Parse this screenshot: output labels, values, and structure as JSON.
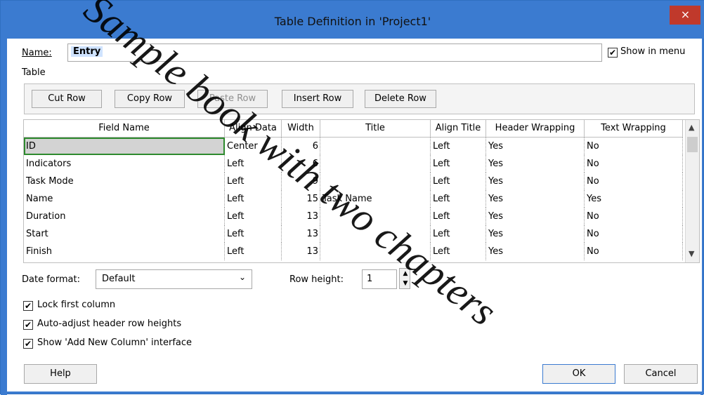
{
  "window": {
    "title": "Table Definition in 'Project1'",
    "close_glyph": "×"
  },
  "name_field": {
    "label": "Name:",
    "value": "Entry"
  },
  "show_in_menu": {
    "label": "Show in menu",
    "checked": true
  },
  "table_section": {
    "label": "Table"
  },
  "toolbar": {
    "buttons": [
      {
        "label": "Cut Row"
      },
      {
        "label": "Copy Row"
      },
      {
        "label": "Paste Row",
        "disabled": true
      },
      {
        "label": "Insert Row"
      },
      {
        "label": "Delete Row"
      }
    ]
  },
  "grid": {
    "columns": [
      "Field Name",
      "Align Data",
      "Width",
      "Title",
      "Align Title",
      "Header Wrapping",
      "Text Wrapping"
    ],
    "rows": [
      [
        "ID",
        "Center",
        "6",
        "",
        "Left",
        "Yes",
        "No"
      ],
      [
        "Indicators",
        "Left",
        "6",
        "",
        "Left",
        "Yes",
        "No"
      ],
      [
        "Task Mode",
        "Left",
        "9",
        "",
        "Left",
        "Yes",
        "No"
      ],
      [
        "Name",
        "Left",
        "15",
        "Task Name",
        "Left",
        "Yes",
        "Yes"
      ],
      [
        "Duration",
        "Left",
        "13",
        "",
        "Left",
        "Yes",
        "No"
      ],
      [
        "Start",
        "Left",
        "13",
        "",
        "Left",
        "Yes",
        "No"
      ],
      [
        "Finish",
        "Left",
        "13",
        "",
        "Left",
        "Yes",
        "No"
      ]
    ]
  },
  "date_format": {
    "label": "Date format:",
    "value": "Default"
  },
  "row_height": {
    "label": "Row height:",
    "value": "1"
  },
  "options": [
    {
      "label": "Lock first column",
      "checked": true
    },
    {
      "label": "Auto-adjust header row heights",
      "checked": true
    },
    {
      "label": "Show 'Add New Column' interface",
      "checked": true
    }
  ],
  "buttons": {
    "help": "Help",
    "ok": "OK",
    "cancel": "Cancel"
  },
  "watermark": {
    "text": "Sample book with two chapters"
  }
}
